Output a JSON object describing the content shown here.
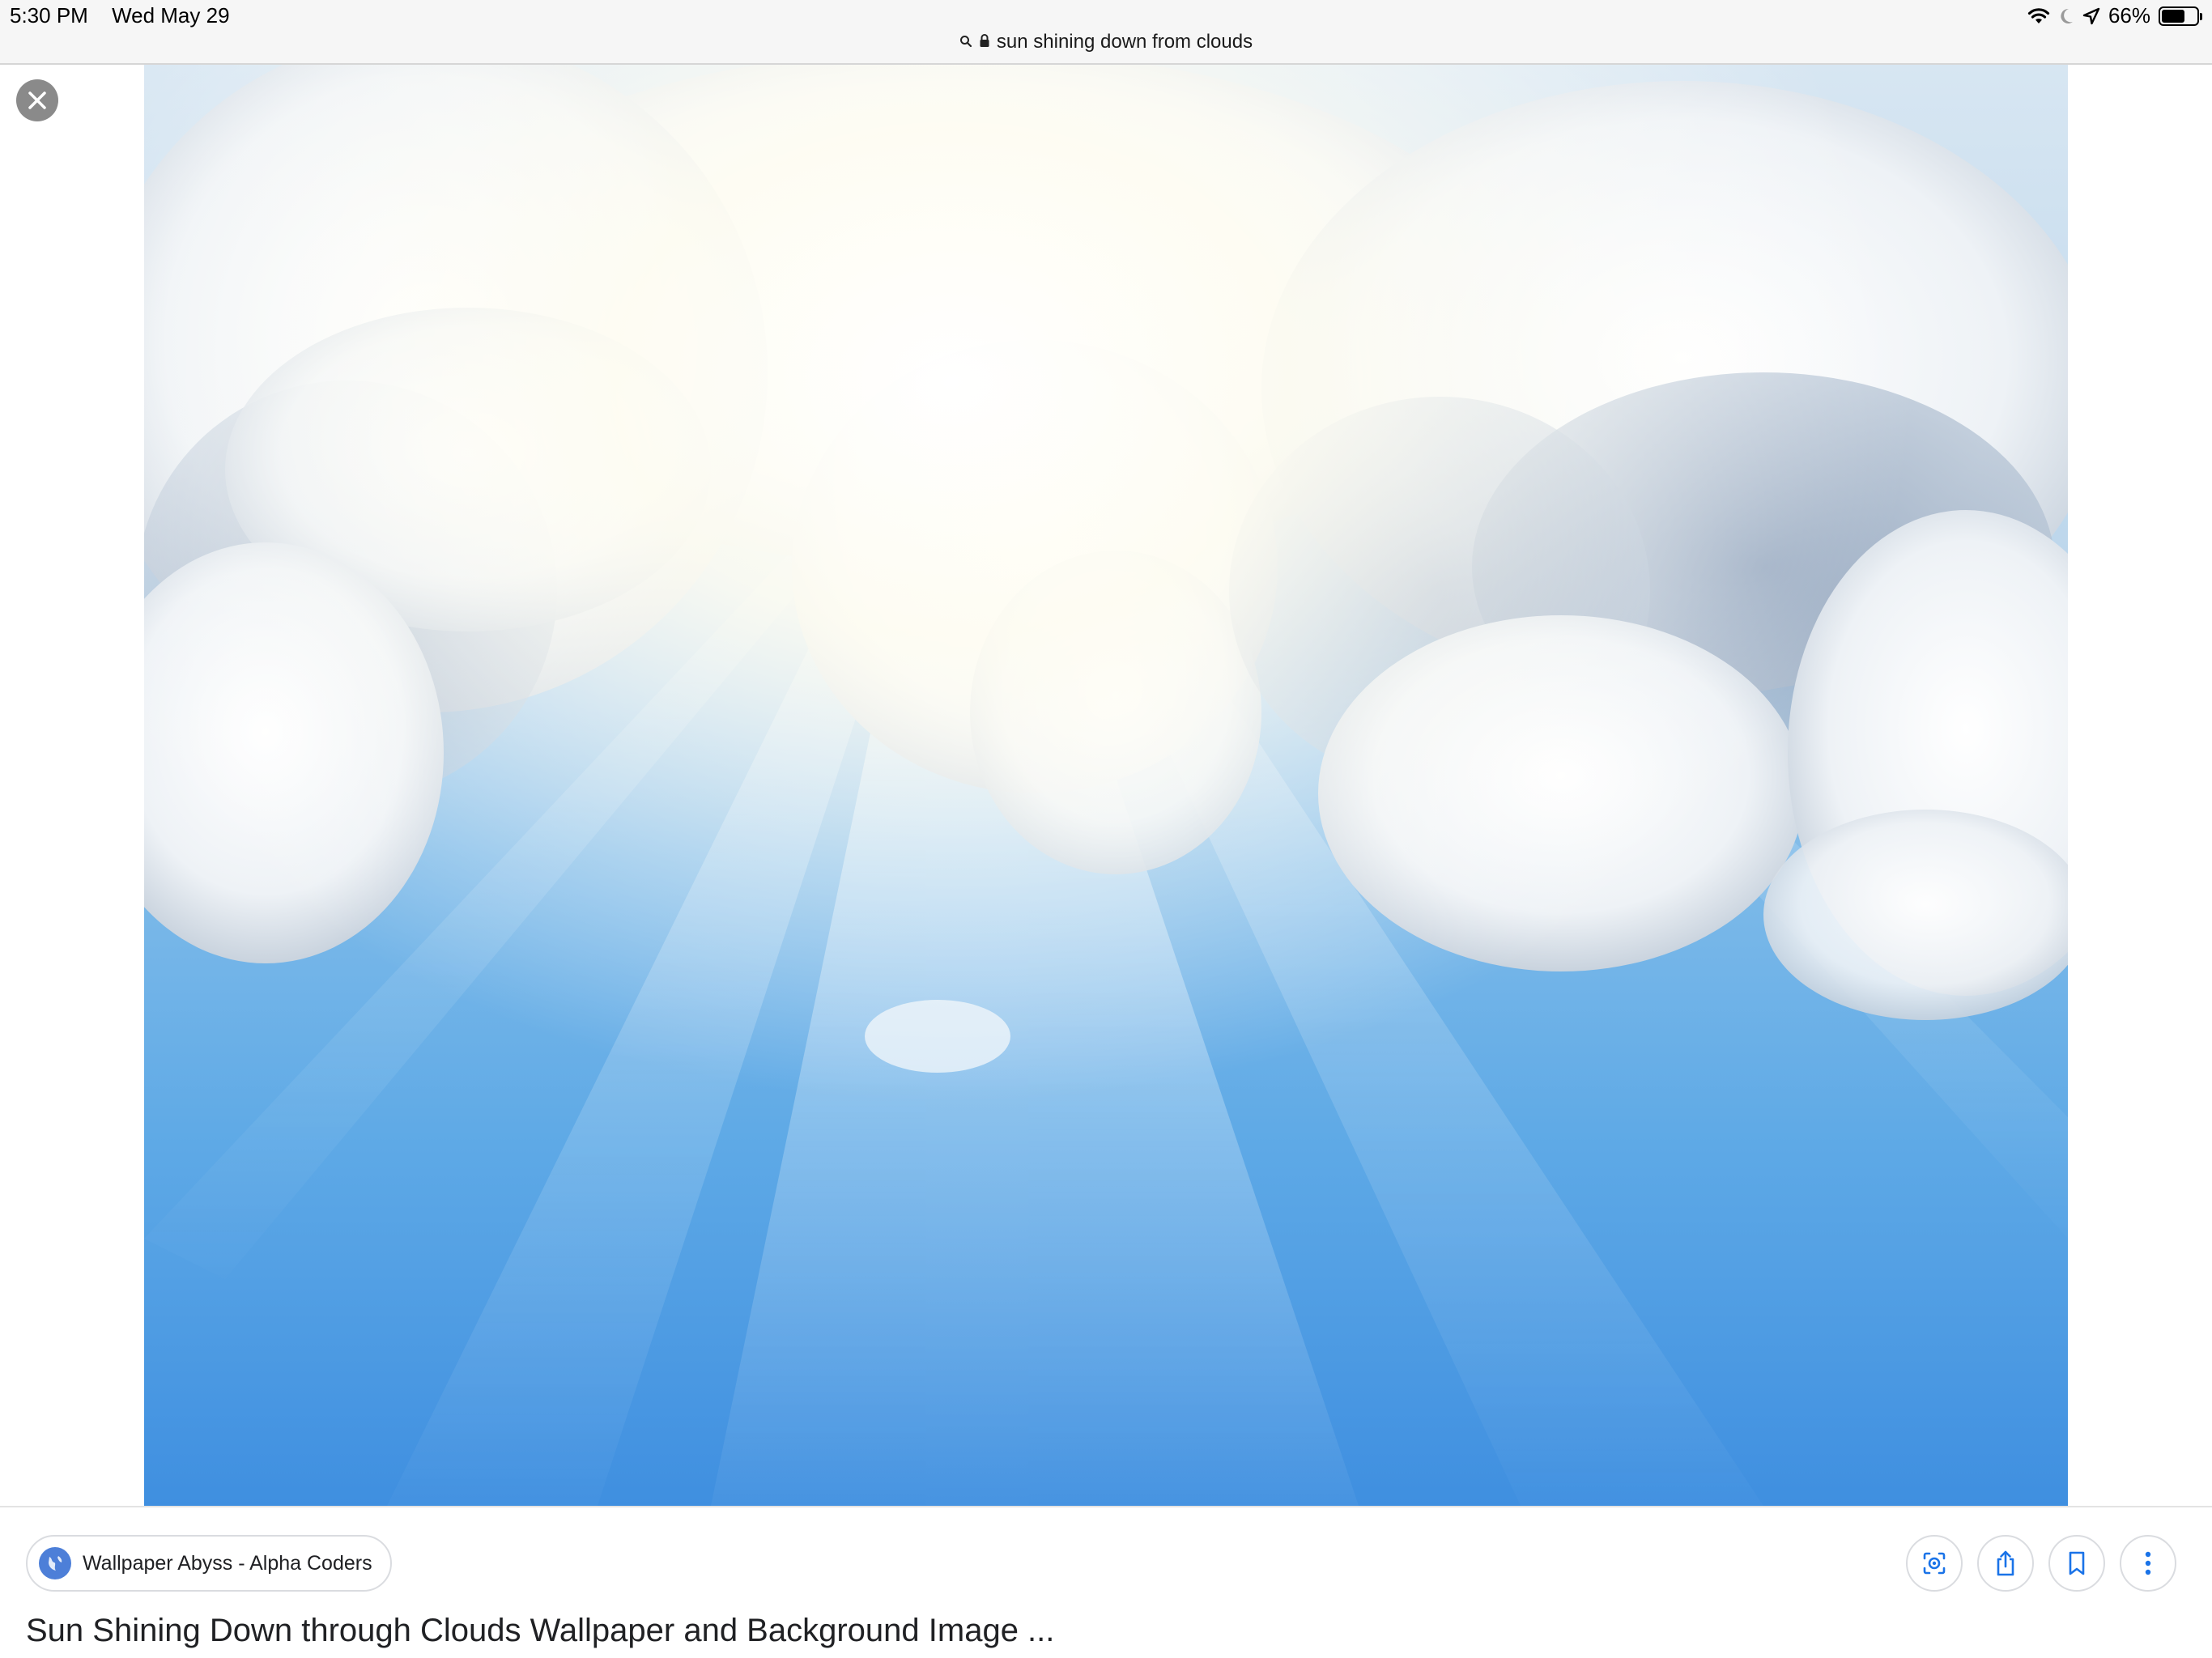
{
  "status_bar": {
    "time": "5:30 PM",
    "date": "Wed May 29",
    "battery_percent_label": "66%",
    "battery_level": 0.66,
    "icons": [
      "wifi-icon",
      "moon-icon",
      "location-arrow-icon",
      "battery-icon"
    ]
  },
  "url_bar": {
    "query": "sun shining down from clouds",
    "icons": [
      "search-icon",
      "lock-icon"
    ]
  },
  "viewer": {
    "close_icon": "close-icon"
  },
  "result": {
    "source_name": "Wallpaper Abyss - Alpha Coders",
    "source_icon": "globe-icon",
    "title": "Sun Shining Down through Clouds Wallpaper and Background Image ...",
    "actions": [
      "lens-icon",
      "share-icon",
      "bookmark-icon",
      "more-vertical-icon"
    ]
  },
  "colors": {
    "accent": "#1a73e8",
    "sky_top": "#d7e6f2",
    "sky_bottom": "#3f8fe0"
  }
}
